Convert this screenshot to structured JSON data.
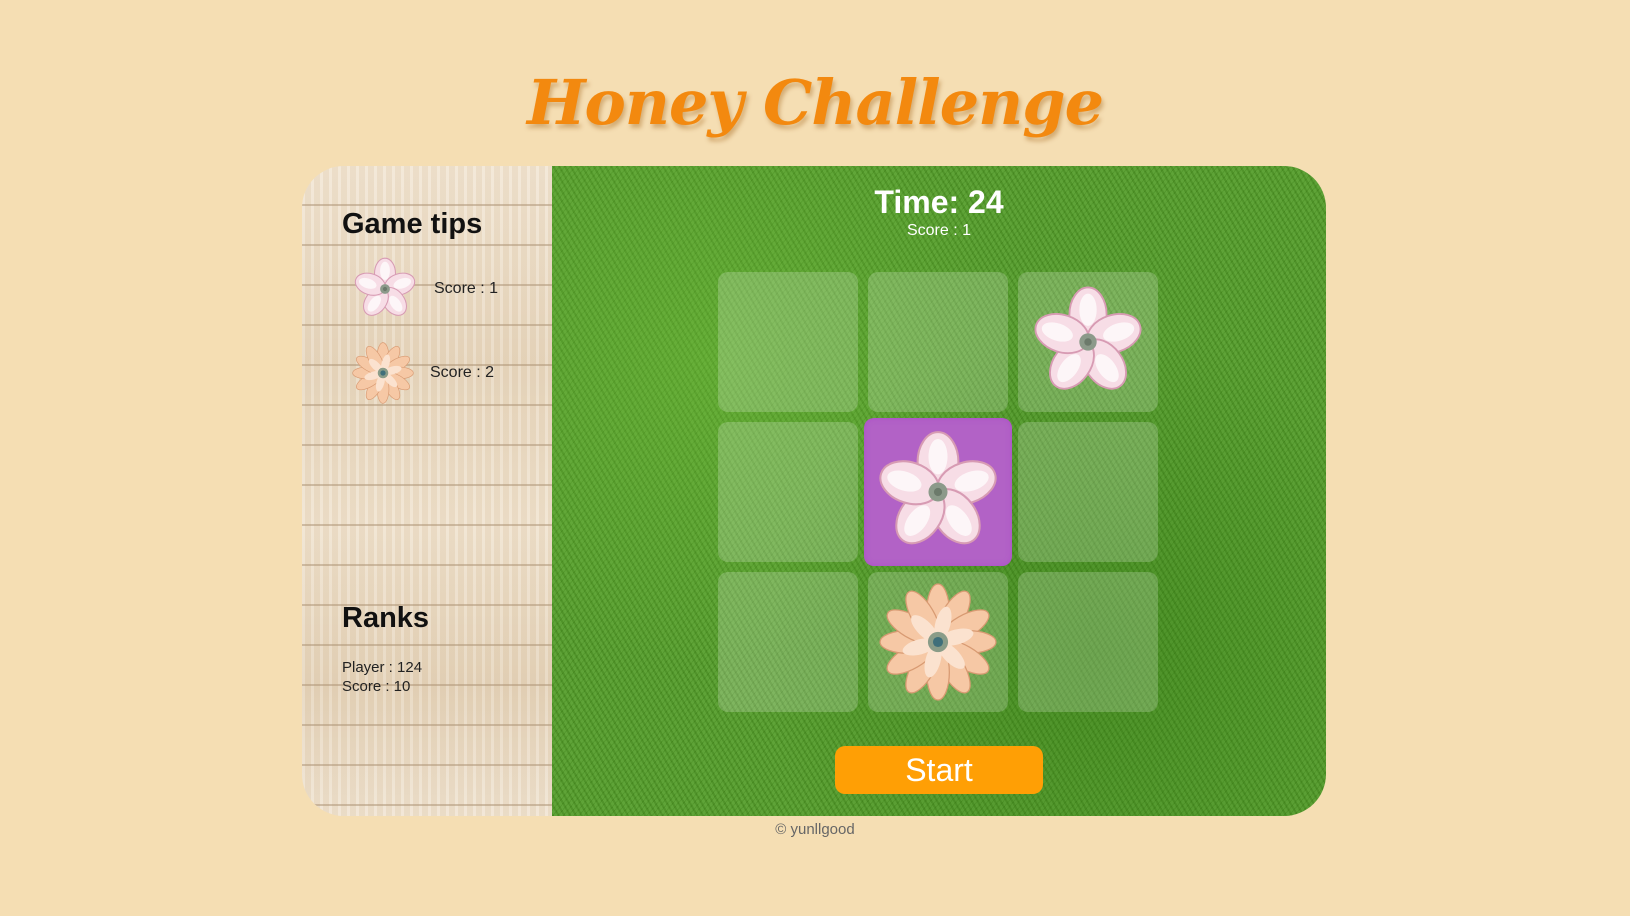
{
  "title": "Honey Challenge",
  "sidebar": {
    "tips_heading": "Game tips",
    "tips": [
      {
        "icon": "pink-flower-icon",
        "label": "Score : 1"
      },
      {
        "icon": "peach-flower-icon",
        "label": "Score : 2"
      }
    ],
    "ranks_heading": "Ranks",
    "ranks": {
      "player": "Player : 124",
      "score": "Score : 10"
    }
  },
  "game": {
    "time": "Time: 24",
    "score": "Score : 1",
    "grid": [
      [
        "empty",
        "empty",
        "pink-flower"
      ],
      [
        "empty",
        "pink-flower-active",
        "empty"
      ],
      [
        "empty",
        "peach-flower",
        "empty"
      ]
    ],
    "start_label": "Start"
  },
  "footer": "© yunllgood",
  "colors": {
    "background": "#f5deb3",
    "title": "#f3890f",
    "start_button": "#ff9f05",
    "active_cell": "#b262c6",
    "grass": "#4f9a24"
  }
}
